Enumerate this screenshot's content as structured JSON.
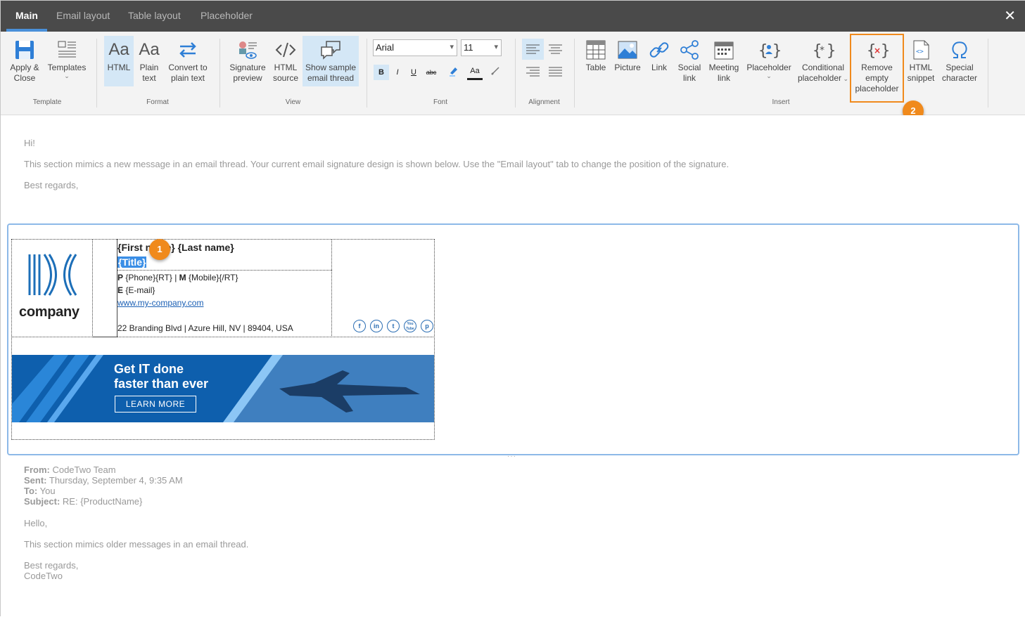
{
  "tabs": [
    "Main",
    "Email layout",
    "Table layout",
    "Placeholder"
  ],
  "close_label": "✕",
  "ribbon": {
    "template": {
      "apply_close": "Apply &",
      "apply_close_2": "Close",
      "templates": "Templates",
      "group": "Template"
    },
    "format": {
      "html": "HTML",
      "plain": "Plain",
      "plain_2": "text",
      "convert": "Convert to",
      "convert_2": "plain text",
      "group": "Format"
    },
    "view": {
      "sig_preview": "Signature",
      "sig_preview_2": "preview",
      "html_source": "HTML",
      "html_source_2": "source",
      "show_sample": "Show sample",
      "show_sample_2": "email thread",
      "group": "View"
    },
    "font": {
      "family": "Arial",
      "size": "11",
      "group": "Font"
    },
    "alignment": {
      "group": "Alignment"
    },
    "insert": {
      "table": "Table",
      "picture": "Picture",
      "link": "Link",
      "social": "Social",
      "social_2": "link",
      "meeting": "Meeting",
      "meeting_2": "link",
      "placeholder": "Placeholder",
      "conditional": "Conditional",
      "conditional_2": "placeholder",
      "remove": "Remove",
      "remove_2": "empty",
      "remove_3": "placeholder",
      "html_snippet": "HTML",
      "html_snippet_2": "snippet",
      "special": "Special",
      "special_2": "character",
      "group": "Insert"
    }
  },
  "message": {
    "greeting": "Hi!",
    "body": "This section mimics a new message in an email thread. Your current email signature design is shown below. Use the \"Email layout\" tab to change the position of the signature.",
    "closing": "Best regards,"
  },
  "signature": {
    "logo_text": "company",
    "name": "{First name} {Last name}",
    "title": "{Title}",
    "phone_label": "P",
    "phone": "{Phone}{RT}",
    "sep": " | ",
    "mobile_label": "M",
    "mobile": "{Mobile}{/RT}",
    "email_label": "E",
    "email": "{E-mail}",
    "website": "www.my-company.com",
    "address": "22 Branding Blvd | Azure Hill, NV | 89404, USA",
    "social": [
      "f",
      "in",
      "t",
      "You Tube",
      "p"
    ],
    "banner": {
      "line1": "Get IT done",
      "line2": "faster than ever",
      "cta": "LEARN MORE"
    }
  },
  "markers": [
    "1",
    "2"
  ],
  "thread": {
    "from_label": "From:",
    "from": " CodeTwo Team",
    "sent_label": "Sent:",
    "sent": " Thursday, September 4, 9:35 AM",
    "to_label": "To:",
    "to": " You",
    "subject_label": "Subject:",
    "subject": " RE: {ProductName}",
    "hello": "Hello,",
    "body": "This section mimics older messages in an email thread.",
    "closing": "Best regards,",
    "signoff": "CodeTwo"
  },
  "colors": {
    "accent": "#4a90d9",
    "highlight": "#f08a1c",
    "selected": "#d4e7f6",
    "titlebar": "#4a4a4a"
  }
}
